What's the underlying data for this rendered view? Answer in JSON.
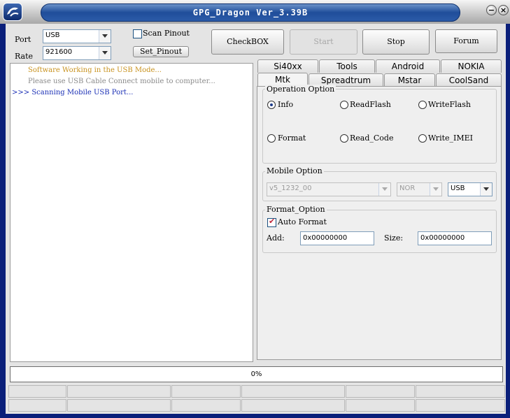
{
  "window": {
    "title": "GPG_Dragon  Ver_3.39B"
  },
  "port": {
    "label": "Port",
    "value": "USB"
  },
  "rate": {
    "label": "Rate",
    "value": "921600"
  },
  "scan_pinout": {
    "label": "Scan Pinout",
    "checked": false
  },
  "set_pinout": {
    "label": "Set_Pinout"
  },
  "buttons": {
    "checkbox": "CheckBOX",
    "start": "Start",
    "stop": "Stop",
    "forum": "Forum"
  },
  "log": [
    {
      "prefix": "",
      "text": "Software Working in the USB Mode...",
      "color": "#c8921e"
    },
    {
      "prefix": "",
      "text": "Please use USB Cable Connect mobile to computer...",
      "color": "#8a8a8a"
    },
    {
      "prefix": ">>>",
      "text": "Scanning Mobile USB Port...",
      "color": "#1a2fb5"
    }
  ],
  "tabs_row1": [
    "Si40xx",
    "Tools",
    "Android",
    "NOKIA"
  ],
  "tabs_row2": [
    "Mtk",
    "Spreadtrum",
    "Mstar",
    "CoolSand"
  ],
  "selected_tab": "Mtk",
  "operation": {
    "title": "Operation Option",
    "options": [
      "Info",
      "ReadFlash",
      "WriteFlash",
      "Format",
      "Read_Code",
      "Write_IMEI"
    ],
    "selected": "Info"
  },
  "mobile": {
    "title": "Mobile Option",
    "version": "v5_1232_00",
    "flash": "NOR",
    "conn": "USB"
  },
  "format": {
    "title": "Format_Option",
    "auto_format": {
      "label": "Auto Format",
      "checked": true
    },
    "add_label": "Add:",
    "add_value": "0x00000000",
    "size_label": "Size:",
    "size_value": "0x00000000"
  },
  "progress": {
    "text": "0%",
    "value": 0
  }
}
